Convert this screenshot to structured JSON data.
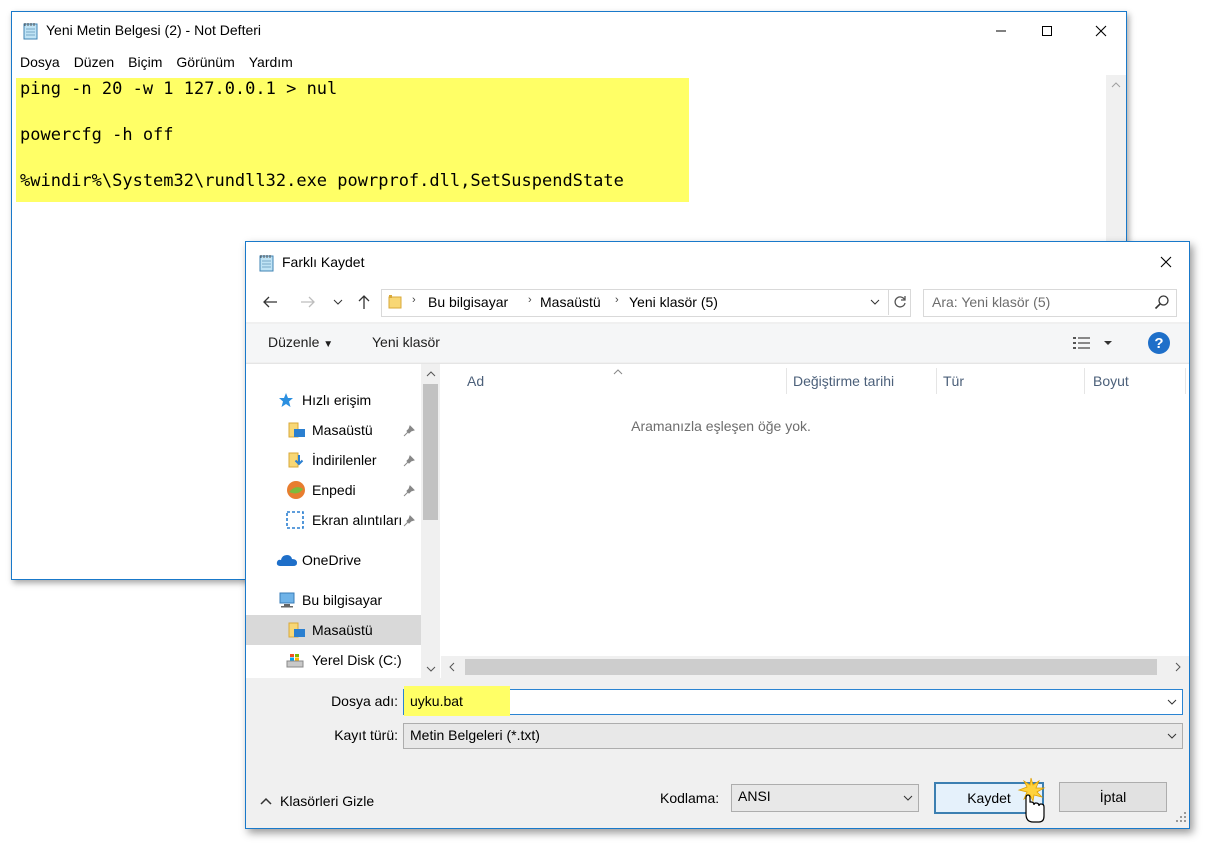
{
  "notepad": {
    "title": "Yeni Metin Belgesi (2) - Not Defteri",
    "menu": [
      "Dosya",
      "Düzen",
      "Biçim",
      "Görünüm",
      "Yardım"
    ],
    "lines": [
      "ping -n 20 -w 1 127.0.0.1 > nul",
      "powercfg -h off",
      "%windir%\\System32\\rundll32.exe powrprof.dll,SetSuspendState"
    ],
    "highlight_color": "#ffff66"
  },
  "dialog": {
    "title": "Farklı Kaydet",
    "breadcrumb": [
      "Bu bilgisayar",
      "Masaüstü",
      "Yeni klasör (5)"
    ],
    "search_placeholder": "Ara: Yeni klasör (5)",
    "toolbar": {
      "organize": "Düzenle",
      "new_folder": "Yeni klasör"
    },
    "nav_items": [
      {
        "label": "Hızlı erişim",
        "icon": "star-icon",
        "pinned": false,
        "selected": false
      },
      {
        "label": "Masaüstü",
        "icon": "desktop-folder-icon",
        "pinned": true,
        "selected": false
      },
      {
        "label": "İndirilenler",
        "icon": "downloads-folder-icon",
        "pinned": true,
        "selected": false
      },
      {
        "label": "Enpedi",
        "icon": "enpedi-icon",
        "pinned": true,
        "selected": false
      },
      {
        "label": "Ekran alıntıları",
        "icon": "screenshot-icon",
        "pinned": true,
        "selected": false
      },
      {
        "label": "OneDrive",
        "icon": "onedrive-icon",
        "pinned": false,
        "selected": false
      },
      {
        "label": "Bu bilgisayar",
        "icon": "computer-icon",
        "pinned": false,
        "selected": false
      },
      {
        "label": "Masaüstü",
        "icon": "desktop-folder-icon",
        "pinned": false,
        "selected": true
      },
      {
        "label": "Yerel Disk (C:)",
        "icon": "drive-icon",
        "pinned": false,
        "selected": false
      }
    ],
    "columns": [
      "Ad",
      "Değiştirme tarihi",
      "Tür",
      "Boyut"
    ],
    "empty_message": "Aramanızla eşleşen öğe yok.",
    "file_name_label": "Dosya adı:",
    "file_name_value": "uyku.bat",
    "save_type_label": "Kayıt türü:",
    "save_type_value": "Metin Belgeleri (*.txt)",
    "hide_folders": "Klasörleri Gizle",
    "encoding_label": "Kodlama:",
    "encoding_value": "ANSI",
    "save_button": "Kaydet",
    "cancel_button": "İptal",
    "accent_color": "#1979ca"
  }
}
